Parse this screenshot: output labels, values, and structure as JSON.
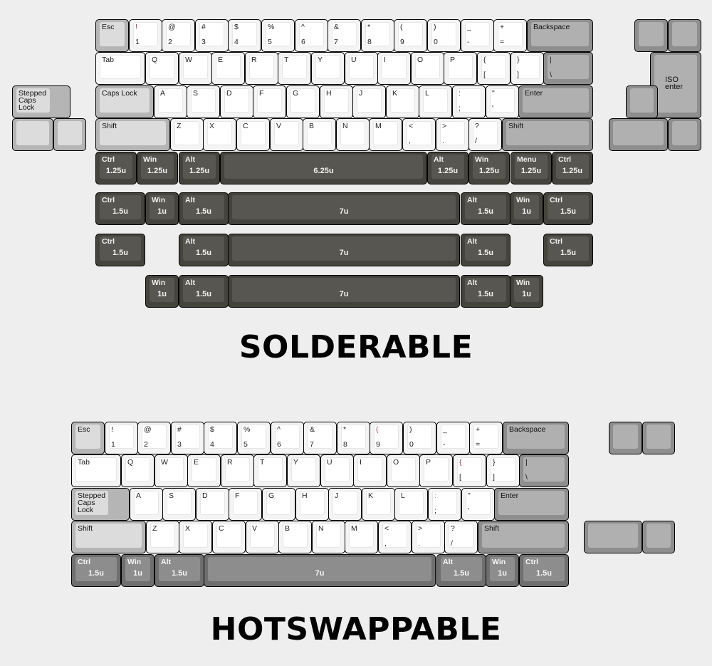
{
  "solderable": {
    "title": "SOLDERABLE",
    "rows": [
      [
        {
          "t": "Esc",
          "w": 1,
          "c": "light"
        },
        {
          "t": "!",
          "b": "1",
          "w": 1,
          "c": "white",
          "tc": "#c0306a"
        },
        {
          "t": "@",
          "b": "2",
          "w": 1,
          "c": "white"
        },
        {
          "t": "#",
          "b": "3",
          "w": 1,
          "c": "white"
        },
        {
          "t": "$",
          "b": "4",
          "w": 1,
          "c": "white"
        },
        {
          "t": "%",
          "b": "5",
          "w": 1,
          "c": "white"
        },
        {
          "t": "^",
          "b": "6",
          "w": 1,
          "c": "white"
        },
        {
          "t": "&",
          "b": "7",
          "w": 1,
          "c": "white"
        },
        {
          "t": "*",
          "b": "8",
          "w": 1,
          "c": "white"
        },
        {
          "t": "(",
          "b": "9",
          "w": 1,
          "c": "white"
        },
        {
          "t": ")",
          "b": "0",
          "w": 1,
          "c": "white"
        },
        {
          "t": "_",
          "b": "-",
          "w": 1,
          "c": "white"
        },
        {
          "t": "+",
          "b": "=",
          "w": 1,
          "c": "white"
        },
        {
          "t": "Backspace",
          "w": 2,
          "c": "gray"
        }
      ],
      [
        {
          "t": "Tab",
          "w": 1.5,
          "c": "white"
        },
        {
          "t": "Q",
          "w": 1,
          "c": "white"
        },
        {
          "t": "W",
          "w": 1,
          "c": "white"
        },
        {
          "t": "E",
          "w": 1,
          "c": "white"
        },
        {
          "t": "R",
          "w": 1,
          "c": "white"
        },
        {
          "t": "T",
          "w": 1,
          "c": "white"
        },
        {
          "t": "Y",
          "w": 1,
          "c": "white"
        },
        {
          "t": "U",
          "w": 1,
          "c": "white"
        },
        {
          "t": "I",
          "w": 1,
          "c": "white"
        },
        {
          "t": "O",
          "w": 1,
          "c": "white"
        },
        {
          "t": "P",
          "w": 1,
          "c": "white"
        },
        {
          "t": "{",
          "b": "[",
          "w": 1,
          "c": "white"
        },
        {
          "t": "}",
          "b": "]",
          "w": 1,
          "c": "white"
        },
        {
          "t": "|",
          "b": "\\",
          "w": 1.5,
          "c": "gray"
        }
      ],
      [
        {
          "t": "Caps Lock",
          "w": 1.75,
          "c": "light"
        },
        {
          "t": "A",
          "w": 1,
          "c": "white"
        },
        {
          "t": "S",
          "w": 1,
          "c": "white"
        },
        {
          "t": "D",
          "w": 1,
          "c": "white"
        },
        {
          "t": "F",
          "w": 1,
          "c": "white"
        },
        {
          "t": "G",
          "w": 1,
          "c": "white"
        },
        {
          "t": "H",
          "w": 1,
          "c": "white"
        },
        {
          "t": "J",
          "w": 1,
          "c": "white"
        },
        {
          "t": "K",
          "w": 1,
          "c": "white"
        },
        {
          "t": "L",
          "w": 1,
          "c": "white"
        },
        {
          "t": ":",
          "b": ";",
          "w": 1,
          "c": "white"
        },
        {
          "t": "\"",
          "b": "'",
          "w": 1,
          "c": "white"
        },
        {
          "t": "Enter",
          "w": 2.25,
          "c": "gray"
        }
      ],
      [
        {
          "t": "Shift",
          "w": 2.25,
          "c": "light"
        },
        {
          "t": "Z",
          "w": 1,
          "c": "white"
        },
        {
          "t": "X",
          "w": 1,
          "c": "white"
        },
        {
          "t": "C",
          "w": 1,
          "c": "white"
        },
        {
          "t": "V",
          "w": 1,
          "c": "white"
        },
        {
          "t": "B",
          "w": 1,
          "c": "white"
        },
        {
          "t": "N",
          "w": 1,
          "c": "white"
        },
        {
          "t": "M",
          "w": 1,
          "c": "white"
        },
        {
          "t": "<",
          "b": ",",
          "w": 1,
          "c": "white"
        },
        {
          "t": ">",
          "b": ".",
          "w": 1,
          "c": "white"
        },
        {
          "t": "?",
          "b": "/",
          "w": 1,
          "c": "white"
        },
        {
          "t": "Shift",
          "w": 2.75,
          "c": "gray"
        }
      ],
      [
        {
          "t": "Ctrl",
          "m": "1.25u",
          "w": 1.25,
          "c": "dark"
        },
        {
          "t": "Win",
          "m": "1.25u",
          "w": 1.25,
          "c": "dark"
        },
        {
          "t": "Alt",
          "m": "1.25u",
          "w": 1.25,
          "c": "dark"
        },
        {
          "m": "6.25u",
          "w": 6.25,
          "c": "dark"
        },
        {
          "t": "Alt",
          "m": "1.25u",
          "w": 1.25,
          "c": "dark"
        },
        {
          "t": "Win",
          "m": "1.25u",
          "w": 1.25,
          "c": "dark"
        },
        {
          "t": "Menu",
          "m": "1.25u",
          "w": 1.25,
          "c": "dark"
        },
        {
          "t": "Ctrl",
          "m": "1.25u",
          "w": 1.25,
          "c": "dark"
        }
      ]
    ],
    "bottom_alts": [
      [
        {
          "t": "Ctrl",
          "m": "1.5u",
          "w": 1.5,
          "c": "dark"
        },
        {
          "t": "Win",
          "m": "1u",
          "w": 1,
          "c": "dark"
        },
        {
          "t": "Alt",
          "m": "1.5u",
          "w": 1.5,
          "c": "dark"
        },
        {
          "m": "7u",
          "w": 7,
          "c": "dark"
        },
        {
          "t": "Alt",
          "m": "1.5u",
          "w": 1.5,
          "c": "dark"
        },
        {
          "t": "Win",
          "m": "1u",
          "w": 1,
          "c": "dark"
        },
        {
          "t": "Ctrl",
          "m": "1.5u",
          "w": 1.5,
          "c": "dark"
        }
      ],
      [
        {
          "t": "Ctrl",
          "m": "1.5u",
          "w": 1.5,
          "c": "dark"
        },
        {
          "gap": 1
        },
        {
          "t": "Alt",
          "m": "1.5u",
          "w": 1.5,
          "c": "dark"
        },
        {
          "m": "7u",
          "w": 7,
          "c": "dark"
        },
        {
          "t": "Alt",
          "m": "1.5u",
          "w": 1.5,
          "c": "dark"
        },
        {
          "gap": 1
        },
        {
          "t": "Ctrl",
          "m": "1.5u",
          "w": 1.5,
          "c": "dark"
        }
      ],
      [
        {
          "gap": 1.5
        },
        {
          "t": "Win",
          "m": "1u",
          "w": 1,
          "c": "dark"
        },
        {
          "t": "Alt",
          "m": "1.5u",
          "w": 1.5,
          "c": "dark"
        },
        {
          "m": "7u",
          "w": 7,
          "c": "dark"
        },
        {
          "t": "Alt",
          "m": "1.5u",
          "w": 1.5,
          "c": "dark"
        },
        {
          "t": "Win",
          "m": "1u",
          "w": 1,
          "c": "dark"
        }
      ]
    ],
    "extras": {
      "stepped_caps": {
        "t": "Stepped\nCaps\nLock"
      },
      "iso_enter": {
        "t": "ISO\nenter"
      }
    }
  },
  "hotswappable": {
    "title": "HOTSWAPPABLE",
    "rows": [
      [
        {
          "t": "Esc",
          "w": 1,
          "c": "light"
        },
        {
          "t": "!",
          "b": "1",
          "w": 1,
          "c": "white"
        },
        {
          "t": "@",
          "b": "2",
          "w": 1,
          "c": "white"
        },
        {
          "t": "#",
          "b": "3",
          "w": 1,
          "c": "white"
        },
        {
          "t": "$",
          "b": "4",
          "w": 1,
          "c": "white"
        },
        {
          "t": "%",
          "b": "5",
          "w": 1,
          "c": "white"
        },
        {
          "t": "^",
          "b": "6",
          "w": 1,
          "c": "white"
        },
        {
          "t": "&",
          "b": "7",
          "w": 1,
          "c": "white"
        },
        {
          "t": "*",
          "b": "8",
          "w": 1,
          "c": "white"
        },
        {
          "t": "(",
          "b": "9",
          "w": 1,
          "c": "white",
          "tc": "#c0306a"
        },
        {
          "t": ")",
          "b": "0",
          "w": 1,
          "c": "white"
        },
        {
          "t": "_",
          "b": "-",
          "w": 1,
          "c": "white"
        },
        {
          "t": "+",
          "b": "=",
          "w": 1,
          "c": "white"
        },
        {
          "t": "Backspace",
          "w": 2,
          "c": "gray"
        }
      ],
      [
        {
          "t": "Tab",
          "w": 1.5,
          "c": "white"
        },
        {
          "t": "Q",
          "w": 1,
          "c": "white"
        },
        {
          "t": "W",
          "w": 1,
          "c": "white"
        },
        {
          "t": "E",
          "w": 1,
          "c": "white"
        },
        {
          "t": "R",
          "w": 1,
          "c": "white"
        },
        {
          "t": "T",
          "w": 1,
          "c": "white"
        },
        {
          "t": "Y",
          "w": 1,
          "c": "white"
        },
        {
          "t": "U",
          "w": 1,
          "c": "white"
        },
        {
          "t": "I",
          "w": 1,
          "c": "white"
        },
        {
          "t": "O",
          "w": 1,
          "c": "white"
        },
        {
          "t": "P",
          "w": 1,
          "c": "white"
        },
        {
          "t": "{",
          "b": "[",
          "w": 1,
          "c": "white",
          "tc": "#c0306a"
        },
        {
          "t": "}",
          "b": "]",
          "w": 1,
          "c": "white"
        },
        {
          "t": "|",
          "b": "\\",
          "w": 1.5,
          "c": "gray"
        }
      ],
      [
        {
          "t": "Stepped\nCaps\nLock",
          "w": 1.75,
          "c": "light",
          "stepped": true
        },
        {
          "t": "A",
          "w": 1,
          "c": "white"
        },
        {
          "t": "S",
          "w": 1,
          "c": "white"
        },
        {
          "t": "D",
          "w": 1,
          "c": "white"
        },
        {
          "t": "F",
          "w": 1,
          "c": "white"
        },
        {
          "t": "G",
          "w": 1,
          "c": "white"
        },
        {
          "t": "H",
          "w": 1,
          "c": "white"
        },
        {
          "t": "J",
          "w": 1,
          "c": "white"
        },
        {
          "t": "K",
          "w": 1,
          "c": "white"
        },
        {
          "t": "L",
          "w": 1,
          "c": "white"
        },
        {
          "t": ":",
          "b": ";",
          "w": 1,
          "c": "white",
          "tc": "#c08a40"
        },
        {
          "t": "\"",
          "b": "'",
          "w": 1,
          "c": "white"
        },
        {
          "t": "Enter",
          "w": 2.25,
          "c": "gray"
        }
      ],
      [
        {
          "t": "Shift",
          "w": 2.25,
          "c": "light"
        },
        {
          "t": "Z",
          "w": 1,
          "c": "white"
        },
        {
          "t": "X",
          "w": 1,
          "c": "white"
        },
        {
          "t": "C",
          "w": 1,
          "c": "white"
        },
        {
          "t": "V",
          "w": 1,
          "c": "white"
        },
        {
          "t": "B",
          "w": 1,
          "c": "white"
        },
        {
          "t": "N",
          "w": 1,
          "c": "white"
        },
        {
          "t": "M",
          "w": 1,
          "c": "white"
        },
        {
          "t": "<",
          "b": ",",
          "w": 1,
          "c": "white"
        },
        {
          "t": ">",
          "b": ".",
          "w": 1,
          "c": "white"
        },
        {
          "t": "?",
          "b": "/",
          "w": 1,
          "c": "white"
        },
        {
          "t": "Shift",
          "w": 2.75,
          "c": "gray"
        }
      ],
      [
        {
          "t": "Ctrl",
          "m": "1.5u",
          "w": 1.5,
          "c": "mid"
        },
        {
          "t": "Win",
          "m": "1u",
          "w": 1,
          "c": "mid"
        },
        {
          "t": "Alt",
          "m": "1.5u",
          "w": 1.5,
          "c": "mid"
        },
        {
          "m": "7u",
          "w": 7,
          "c": "mid"
        },
        {
          "t": "Alt",
          "m": "1.5u",
          "w": 1.5,
          "c": "mid"
        },
        {
          "t": "Win",
          "m": "1u",
          "w": 1,
          "c": "mid"
        },
        {
          "t": "Ctrl",
          "m": "1.5u",
          "w": 1.5,
          "c": "mid"
        }
      ]
    ]
  }
}
